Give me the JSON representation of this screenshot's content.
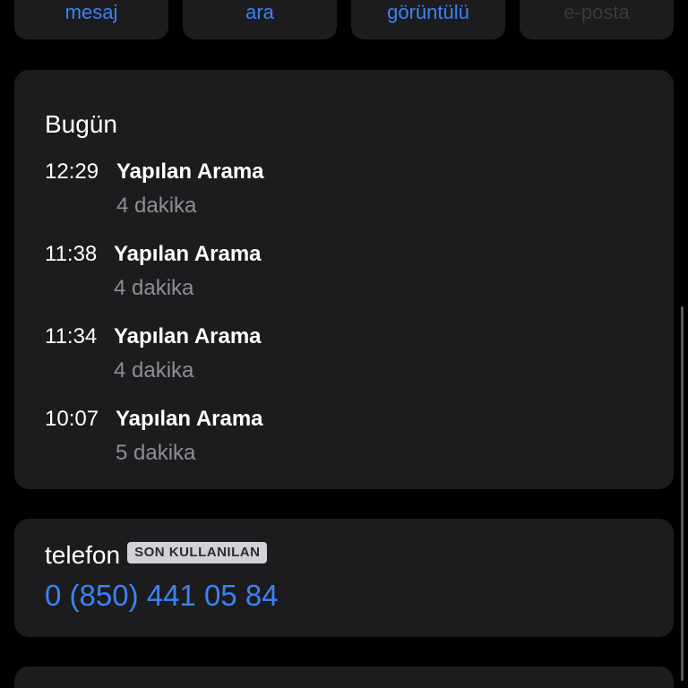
{
  "actions": [
    {
      "label": "mesaj",
      "enabled": true
    },
    {
      "label": "ara",
      "enabled": true
    },
    {
      "label": "görüntülü",
      "enabled": true
    },
    {
      "label": "e-posta",
      "enabled": false
    }
  ],
  "recent_calls": {
    "title": "Bugün",
    "calls": [
      {
        "time": "12:29",
        "type": "Yapılan Arama",
        "duration": "4 dakika"
      },
      {
        "time": "11:38",
        "type": "Yapılan Arama",
        "duration": "4 dakika"
      },
      {
        "time": "11:34",
        "type": "Yapılan Arama",
        "duration": "4 dakika"
      },
      {
        "time": "10:07",
        "type": "Yapılan Arama",
        "duration": "5 dakika"
      }
    ]
  },
  "phone": {
    "label": "telefon",
    "badge": "SON KULLANILAN",
    "number": "0 (850) 441 05 84"
  },
  "colors": {
    "accent": "#3b82f6",
    "card_bg": "#1c1c1e",
    "secondary_text": "#8e8e93"
  }
}
